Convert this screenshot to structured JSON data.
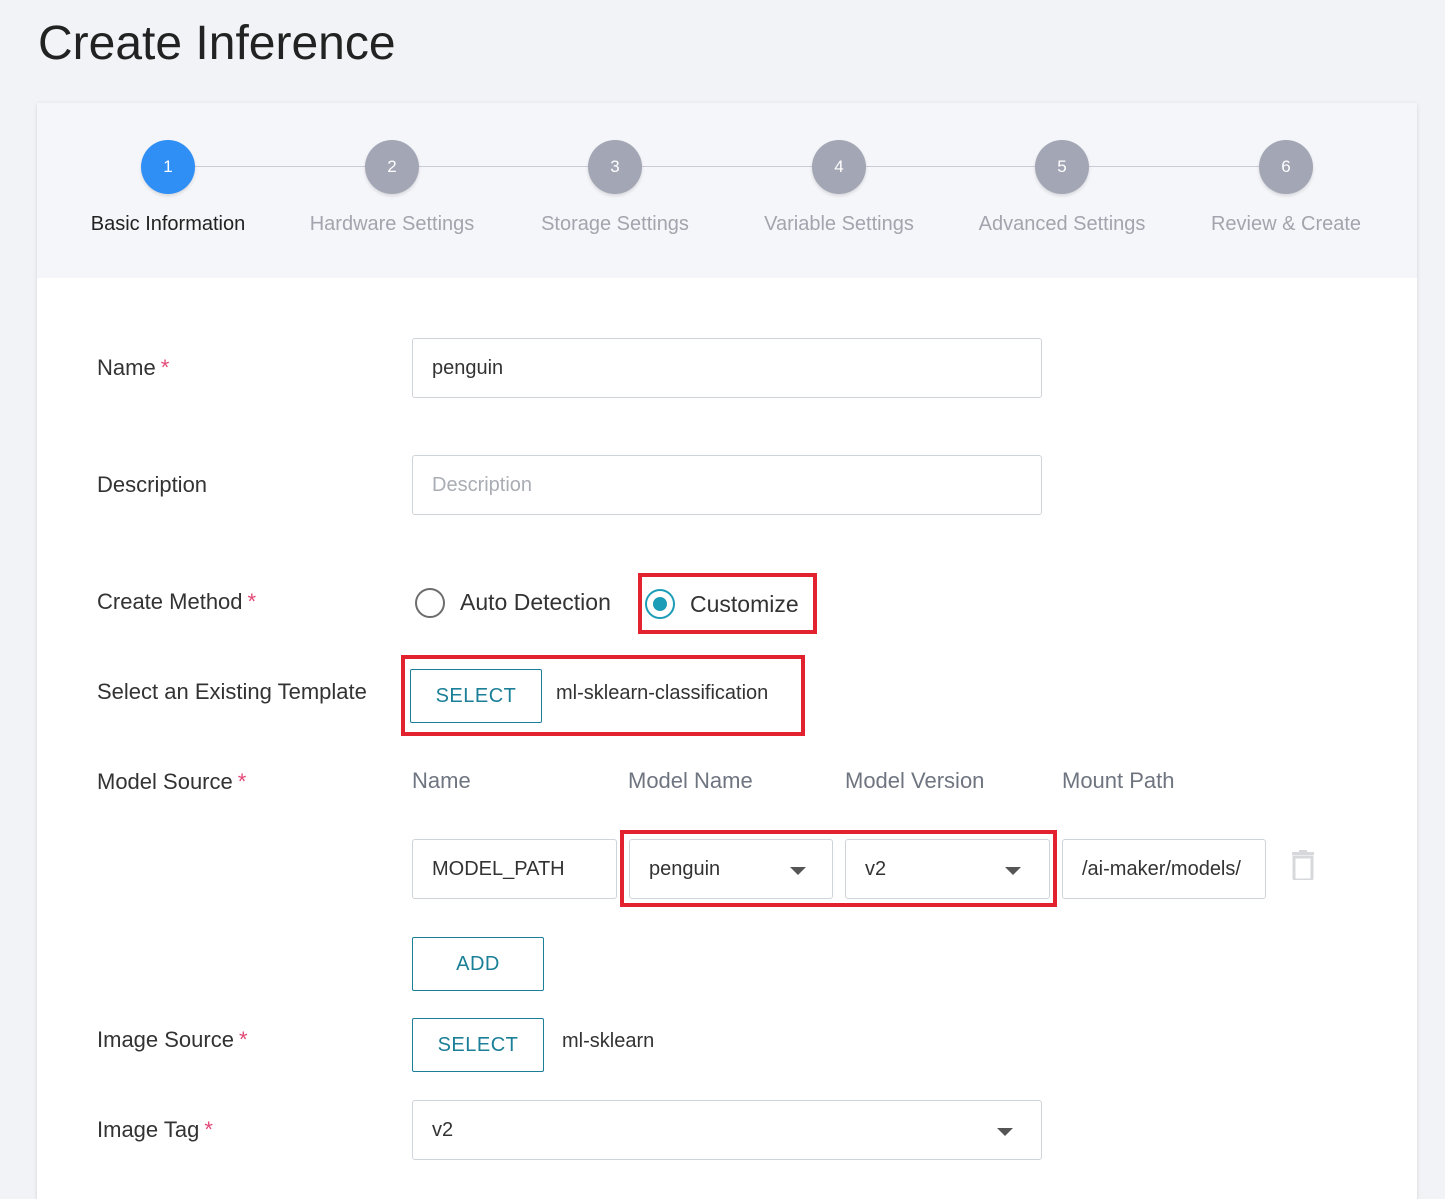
{
  "page": {
    "title": "Create Inference"
  },
  "steps": [
    {
      "number": "1",
      "label": "Basic Information",
      "active": true
    },
    {
      "number": "2",
      "label": "Hardware Settings",
      "active": false
    },
    {
      "number": "3",
      "label": "Storage Settings",
      "active": false
    },
    {
      "number": "4",
      "label": "Variable Settings",
      "active": false
    },
    {
      "number": "5",
      "label": "Advanced Settings",
      "active": false
    },
    {
      "number": "6",
      "label": "Review & Create",
      "active": false
    }
  ],
  "form": {
    "required_mark": "*",
    "name": {
      "label": "Name",
      "value": "penguin"
    },
    "description": {
      "label": "Description",
      "placeholder": "Description",
      "value": ""
    },
    "create_method": {
      "label": "Create Method",
      "options": [
        "Auto Detection",
        "Customize"
      ],
      "selected": "Customize"
    },
    "template": {
      "label": "Select an Existing Template",
      "button": "SELECT",
      "value": "ml-sklearn-classification"
    },
    "model_source": {
      "label": "Model Source",
      "columns": [
        "Name",
        "Model Name",
        "Model Version",
        "Mount Path"
      ],
      "rows": [
        {
          "name": "MODEL_PATH",
          "model_name": "penguin",
          "model_version": "v2",
          "mount_path": "/ai-maker/models/"
        }
      ],
      "add_button": "ADD"
    },
    "image_source": {
      "label": "Image Source",
      "button": "SELECT",
      "value": "ml-sklearn"
    },
    "image_tag": {
      "label": "Image Tag",
      "value": "v2"
    }
  },
  "colors": {
    "accent": "#2f8ff5",
    "teal": "#1a7f97",
    "radio_selected": "#1b9cb7",
    "highlight": "#e3222f",
    "required": "#e34876"
  },
  "icons": {
    "delete_row": "trash-icon",
    "dropdown": "caret-down-icon"
  }
}
